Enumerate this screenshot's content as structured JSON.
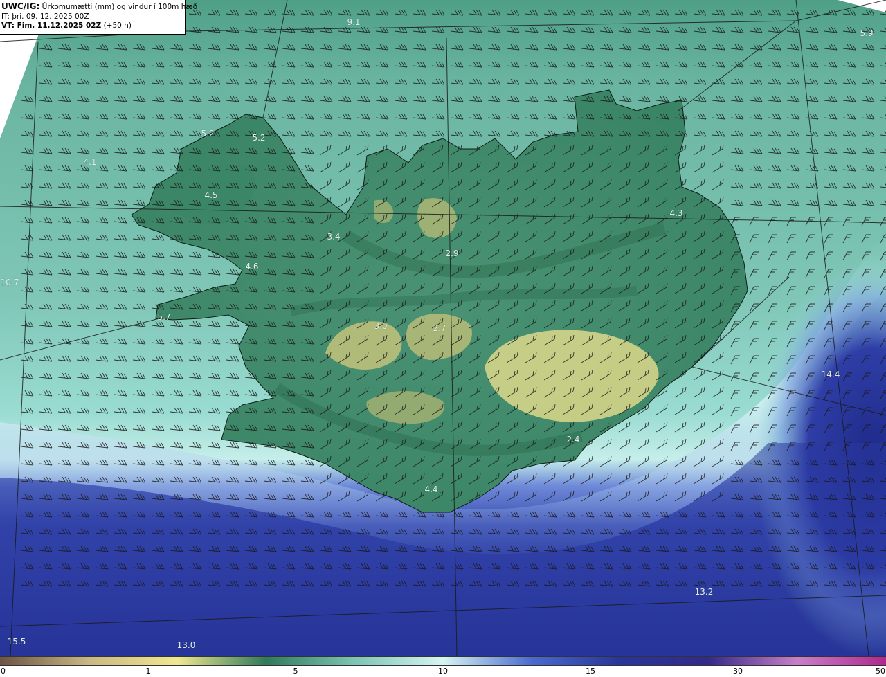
{
  "header": {
    "model": "UWC/IG:",
    "title": "Úrkomumætti (mm) og vindur í 100m hæð",
    "it_prefix": "IT:",
    "issue_time": "þri. 09. 12. 2025 00Z",
    "vt_prefix": "VT: Fim. 11.12.2025 02Z",
    "lead": "(+50 h)"
  },
  "map": {
    "region": "Iceland",
    "land_colors": {
      "low": "#2e7a5c",
      "mid": "#4c9a78",
      "high": "#c8c880",
      "coast": "#76c2b0"
    },
    "ocean_colors": {
      "north": "#8fd2c6",
      "south_band": "#c9f0ec",
      "deep": "#2a3a9e",
      "deepest": "#232e8c"
    },
    "value_labels": [
      {
        "text": "9.1"
      },
      {
        "text": "5.9"
      },
      {
        "text": "5.2"
      },
      {
        "text": "4.1"
      },
      {
        "text": "5.2"
      },
      {
        "text": "4.5"
      },
      {
        "text": "4.3"
      },
      {
        "text": "3.4"
      },
      {
        "text": "2.9"
      },
      {
        "text": "4.6"
      },
      {
        "text": "10.7"
      },
      {
        "text": "5.7"
      },
      {
        "text": "3.0"
      },
      {
        "text": "2.7"
      },
      {
        "text": "14.4"
      },
      {
        "text": "2.4"
      },
      {
        "text": "4.4"
      },
      {
        "text": "13.2"
      },
      {
        "text": "15.5"
      },
      {
        "text": "13.0"
      }
    ]
  },
  "colorbar": {
    "ticks": [
      "0",
      "1",
      "5",
      "10",
      "15",
      "30",
      "50"
    ],
    "colors": [
      "#6b5444",
      "#c8b884",
      "#f0e890",
      "#2f7a5c",
      "#7cc4b4",
      "#d6f5f3",
      "#4a6ad0",
      "#28359a",
      "#342a8a",
      "#c880c8",
      "#b02890"
    ]
  }
}
